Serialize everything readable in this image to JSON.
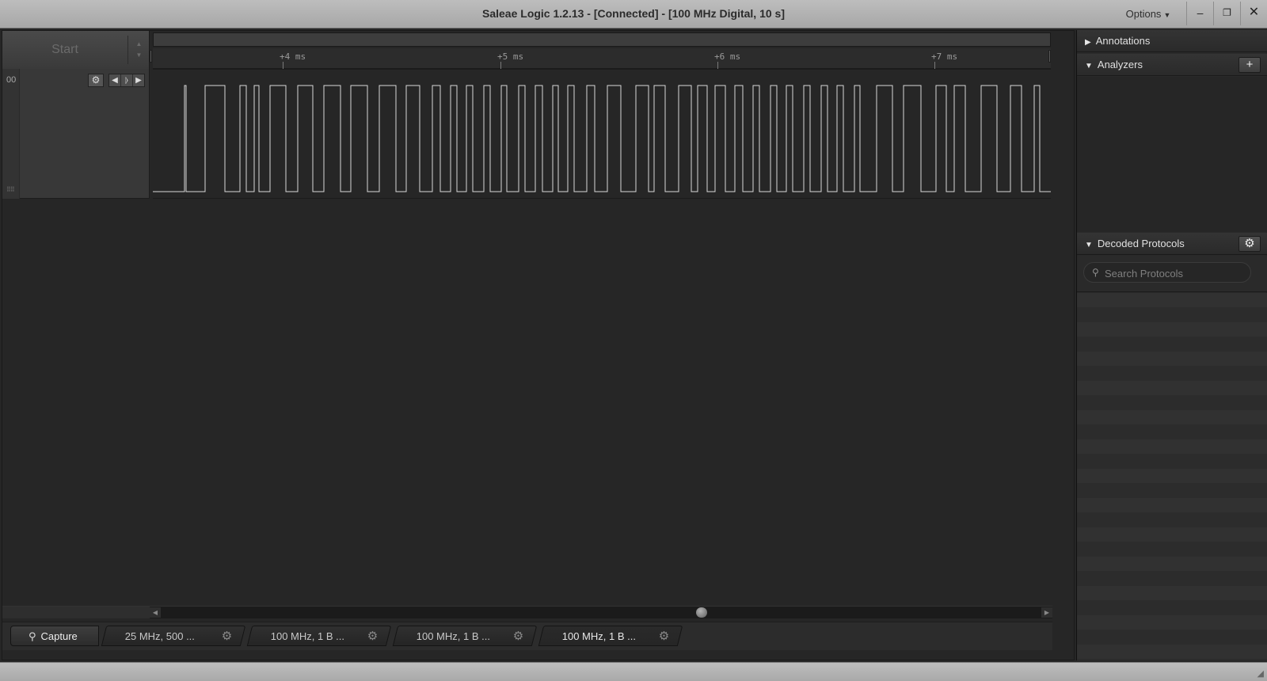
{
  "window": {
    "title": "Saleae Logic 1.2.13 - [Connected] - [100 MHz Digital, 10 s]",
    "options_label": "Options",
    "minimize_glyph": "–",
    "restore_glyph": "❐",
    "close_glyph": "✕"
  },
  "toolbar": {
    "start_label": "Start",
    "start_arrows": "▲▼"
  },
  "timeline": {
    "ticks": [
      "+4 ms",
      "+5 ms",
      "+6 ms",
      "+7 ms"
    ]
  },
  "channel": {
    "number": "00",
    "gear_icon": "gear-icon",
    "trigger_prev": "◀",
    "trigger_edge": "⦊",
    "trigger_next": "▶",
    "signal_levels": [
      0,
      1,
      0,
      1,
      0,
      1,
      0,
      1,
      0,
      1,
      0,
      1,
      0,
      1,
      0,
      1,
      0,
      1,
      0,
      1,
      0,
      1,
      0,
      1,
      0,
      1,
      0,
      1,
      0,
      1,
      0,
      1,
      0,
      1,
      0,
      1,
      0,
      1,
      0,
      1,
      0,
      1,
      0,
      1,
      0,
      1,
      0,
      1,
      0,
      1,
      0,
      1,
      0,
      1,
      0,
      1,
      0,
      1,
      0,
      1,
      0,
      1,
      0,
      1,
      0,
      1,
      0,
      1,
      0,
      1,
      0,
      1,
      0,
      1,
      0,
      1,
      0,
      1,
      0,
      1,
      0,
      1,
      0,
      1,
      0,
      1,
      0,
      1,
      0,
      1,
      0,
      1,
      0,
      1,
      0,
      1,
      0,
      1,
      0,
      1,
      0,
      1,
      0,
      1
    ]
  },
  "tabs": {
    "capture_label": "Capture",
    "items": [
      {
        "label": "25 MHz, 500 ..."
      },
      {
        "label": "100 MHz, 1 B ..."
      },
      {
        "label": "100 MHz, 1 B ..."
      },
      {
        "label": "100 MHz, 1 B ..."
      }
    ]
  },
  "panel": {
    "annotations_label": "Annotations",
    "analyzers_label": "Analyzers",
    "add_glyph": "+",
    "decoded_label": "Decoded Protocols",
    "search_placeholder": "Search Protocols"
  }
}
